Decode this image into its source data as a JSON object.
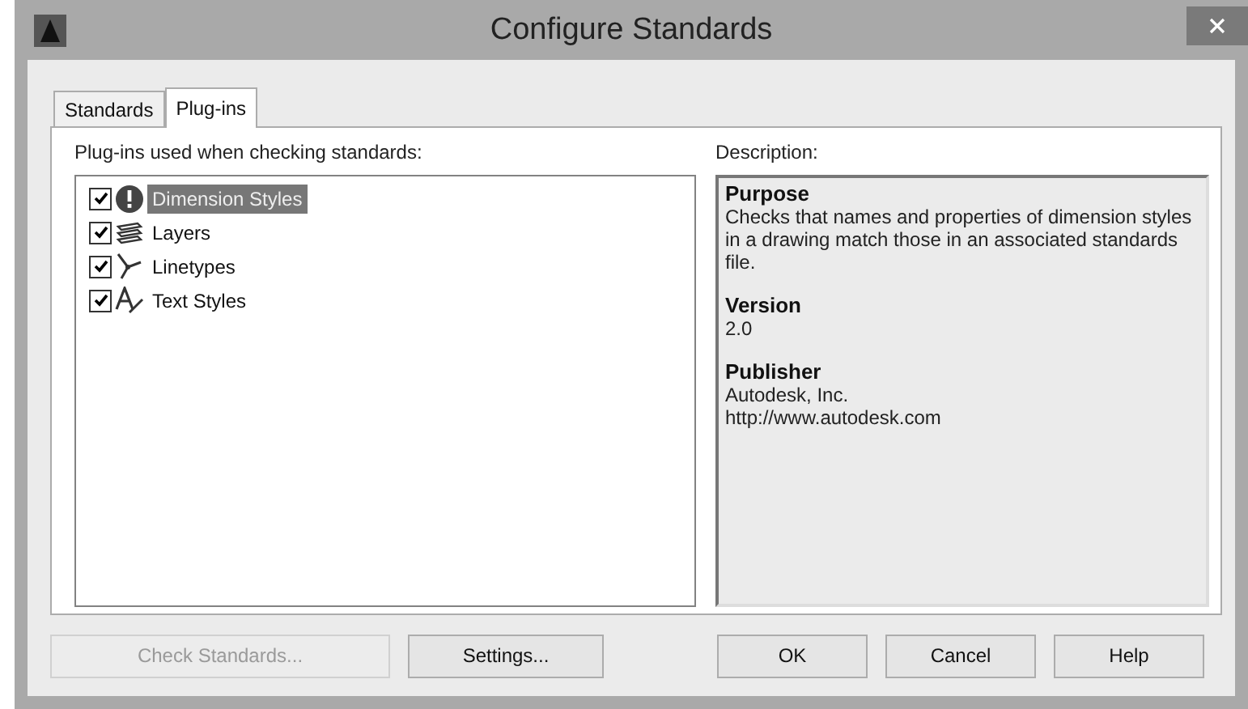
{
  "window": {
    "title": "Configure Standards"
  },
  "tabs": [
    {
      "label": "Standards",
      "selected": false
    },
    {
      "label": "Plug-ins",
      "selected": true
    }
  ],
  "plugins": {
    "label": "Plug-ins used when checking standards:",
    "items": [
      {
        "label": "Dimension Styles",
        "kind": "dimension",
        "checked": true,
        "selected": true
      },
      {
        "label": "Layers",
        "kind": "layers",
        "checked": true,
        "selected": false
      },
      {
        "label": "Linetypes",
        "kind": "linetypes",
        "checked": true,
        "selected": false
      },
      {
        "label": "Text Styles",
        "kind": "text",
        "checked": true,
        "selected": false
      }
    ]
  },
  "description": {
    "label": "Description:",
    "sections": [
      {
        "heading": "Purpose",
        "lines": [
          "Checks that names and properties of dimension styles in a drawing match those in an associated standards file."
        ]
      },
      {
        "heading": "Version",
        "lines": [
          "2.0"
        ]
      },
      {
        "heading": "Publisher",
        "lines": [
          "Autodesk, Inc.",
          "http://www.autodesk.com"
        ]
      }
    ]
  },
  "buttons": [
    {
      "label": "Check Standards...",
      "kind": "left",
      "disabled": true
    },
    {
      "label": "Settings...",
      "kind": "left",
      "disabled": false
    },
    {
      "label": "OK",
      "kind": "right",
      "disabled": false
    },
    {
      "label": "Cancel",
      "kind": "right",
      "disabled": false
    },
    {
      "label": "Help",
      "kind": "right",
      "disabled": false
    }
  ]
}
